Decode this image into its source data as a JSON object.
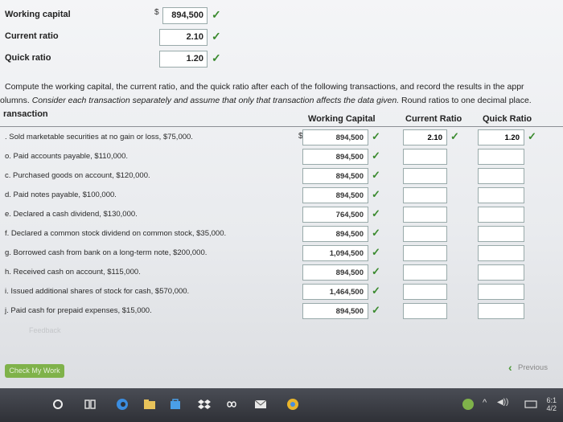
{
  "summary": [
    {
      "label": "Working capital",
      "value": "894,500",
      "currency": "$"
    },
    {
      "label": "Current ratio",
      "value": "2.10"
    },
    {
      "label": "Quick ratio",
      "value": "1.20"
    }
  ],
  "instructions": {
    "line1": "Compute the working capital, the current ratio, and the quick ratio after each of the following transactions, and record the results in the appr",
    "line2_prefix": "olumns. ",
    "line2_italic": "Consider each transaction separately and assume that only that transaction affects the data given.",
    "line2_suffix": " Round ratios to one decimal place."
  },
  "table": {
    "headers": {
      "transaction": "ransaction",
      "working_capital": "Working Capital",
      "current_ratio": "Current Ratio",
      "quick_ratio": "Quick Ratio"
    },
    "rows": [
      {
        "desc": ". Sold marketable securities at no gain or loss, $75,000.",
        "wc": "894,500",
        "cr": "2.10",
        "qr": "1.20",
        "currency": "$"
      },
      {
        "desc": "o. Paid accounts payable, $110,000.",
        "wc": "894,500",
        "cr": "",
        "qr": ""
      },
      {
        "desc": "c. Purchased goods on account, $120,000.",
        "wc": "894,500",
        "cr": "",
        "qr": ""
      },
      {
        "desc": "d. Paid notes payable, $100,000.",
        "wc": "894,500",
        "cr": "",
        "qr": ""
      },
      {
        "desc": "e. Declared a cash dividend, $130,000.",
        "wc": "764,500",
        "cr": "",
        "qr": ""
      },
      {
        "desc": "f. Declared a common stock dividend on common stock, $35,000.",
        "wc": "894,500",
        "cr": "",
        "qr": ""
      },
      {
        "desc": "g. Borrowed cash from bank on a long-term note, $200,000.",
        "wc": "1,094,500",
        "cr": "",
        "qr": ""
      },
      {
        "desc": "h. Received cash on account, $115,000.",
        "wc": "894,500",
        "cr": "",
        "qr": ""
      },
      {
        "desc": "i. Issued additional shares of stock for cash, $570,000.",
        "wc": "1,464,500",
        "cr": "",
        "qr": ""
      },
      {
        "desc": "j. Paid cash for prepaid expenses, $15,000.",
        "wc": "894,500",
        "cr": "",
        "qr": ""
      }
    ]
  },
  "buttons": {
    "check": "Check My Work",
    "previous": "Previous",
    "faint": "Feedback"
  },
  "tray": {
    "time": "6:1",
    "date": "4/2"
  },
  "colors": {
    "check": "#3a8a2e",
    "button": "#7fb24a"
  }
}
